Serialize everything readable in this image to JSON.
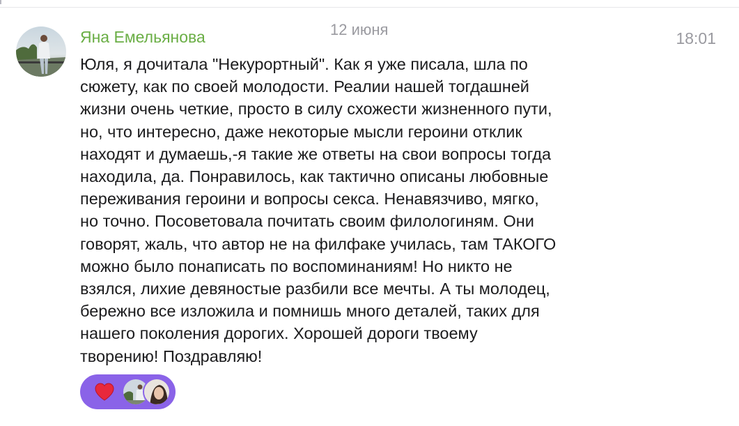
{
  "date_separator": "12 июня",
  "message": {
    "sender": "Яна Емельянова",
    "time": "18:01",
    "lines": [
      "Юля, я дочитала \"Некурортный\". Как я уже писала, шла по",
      "сюжету, как по своей молодости. Реалии нашей тогдашней",
      "жизни очень четкие, просто в силу схожести жизненного пути,",
      "но, что интересно, даже некоторые мысли героини отклик",
      "находят и думаешь,-я такие же ответы на свои вопросы тогда",
      "находила, да. Понравилось, как тактично описаны любовные",
      "переживания героини и вопросы секса. Ненавязчиво, мягко,",
      "но точно. Посоветовала почитать своим филологиням. Они",
      "говорят, жаль, что автор не на филфаке училась, там ТАКОГО",
      "можно было понаписать по воспоминаниям! Но никто не",
      "взялся, лихие девяностые разбили все мечты. А ты молодец,",
      "бережно все изложила и помнишь много деталей, таких для",
      "нашего поколения дорогих. Хорошей дороги твоему",
      "творению! Поздравляю!"
    ],
    "reaction": {
      "emoji_icon": "heart-icon",
      "reactor_count": 2
    }
  },
  "colors": {
    "sender_name": "#6aae45",
    "meta_text": "#9a9aa0",
    "message_text": "#1c1c1e",
    "reaction_pill": "#8a63e8",
    "heart": "#e8283c"
  }
}
